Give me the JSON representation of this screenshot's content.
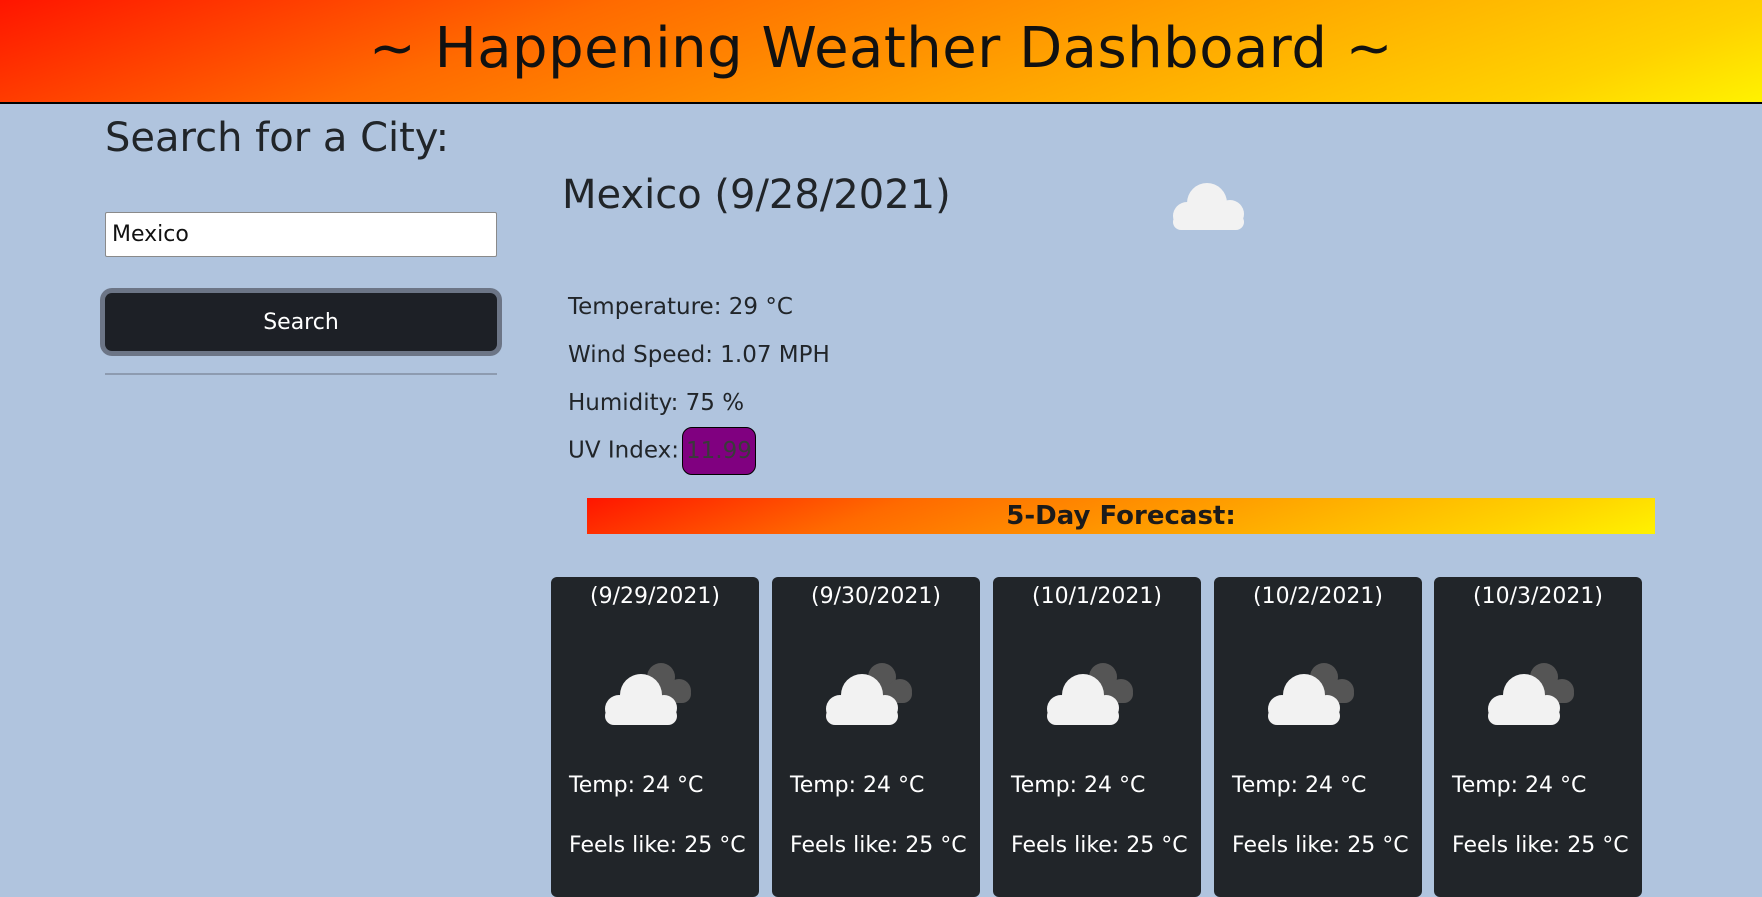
{
  "header": {
    "title": "~ Happening Weather Dashboard ~"
  },
  "sidebar": {
    "heading": "Search for a City:",
    "search_value": "Mexico",
    "search_button_label": "Search"
  },
  "current": {
    "title": "Mexico (9/28/2021)",
    "icon": "cloud-icon",
    "temperature": "Temperature: 29 °C",
    "wind": "Wind Speed: 1.07 MPH",
    "humidity": "Humidity: 75 %",
    "uv_label": "UV Index:",
    "uv_value": "11.99",
    "uv_color": "#800080"
  },
  "forecast": {
    "heading": "5-Day Forecast:",
    "days": [
      {
        "date": "(9/29/2021)",
        "icon": "broken-clouds-icon",
        "temp": "Temp: 24 °C",
        "feels": "Feels like: 25 °C"
      },
      {
        "date": "(9/30/2021)",
        "icon": "broken-clouds-icon",
        "temp": "Temp: 24 °C",
        "feels": "Feels like: 25 °C"
      },
      {
        "date": "(10/1/2021)",
        "icon": "broken-clouds-icon",
        "temp": "Temp: 24 °C",
        "feels": "Feels like: 25 °C"
      },
      {
        "date": "(10/2/2021)",
        "icon": "broken-clouds-icon",
        "temp": "Temp: 24 °C",
        "feels": "Feels like: 25 °C"
      },
      {
        "date": "(10/3/2021)",
        "icon": "broken-clouds-icon",
        "temp": "Temp: 24 °C",
        "feels": "Feels like: 25 °C"
      }
    ]
  },
  "colors": {
    "page_background": "#b0c4de",
    "card_background": "#212529",
    "button_background": "#1d2026"
  }
}
